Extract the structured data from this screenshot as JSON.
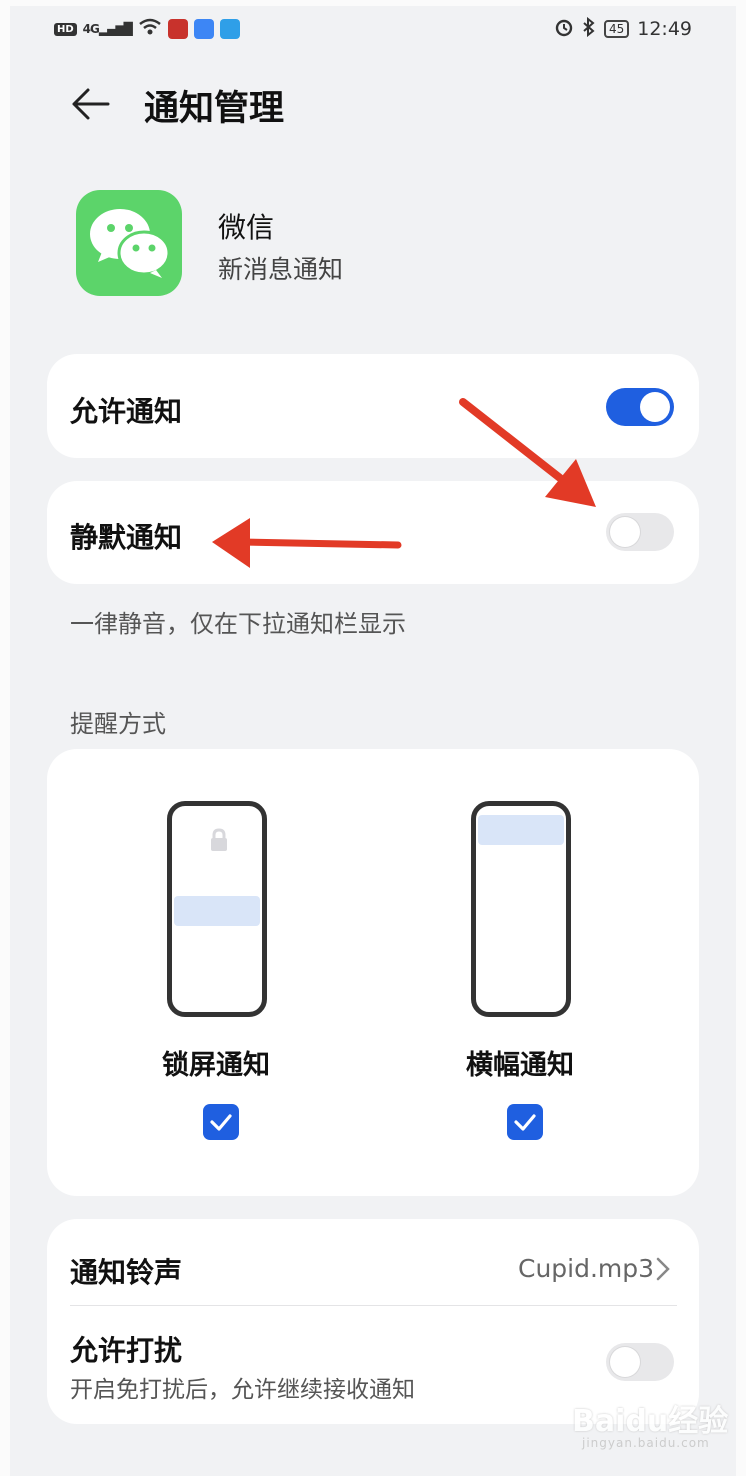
{
  "status_bar": {
    "left_indicators": [
      "HD",
      "4G"
    ],
    "time": "12:49",
    "battery": "45"
  },
  "header": {
    "title": "通知管理",
    "back_icon": "arrow-left-icon"
  },
  "app": {
    "name": "微信",
    "subtitle": "新消息通知",
    "icon": "wechat-icon",
    "icon_color": "#5cd46a"
  },
  "allow_notifications": {
    "label": "允许通知",
    "enabled": true
  },
  "silent_notifications": {
    "label": "静默通知",
    "enabled": false,
    "description": "一律静音，仅在下拉通知栏显示"
  },
  "reminder_style": {
    "section_title": "提醒方式",
    "options": [
      {
        "label": "锁屏通知",
        "checked": true
      },
      {
        "label": "横幅通知",
        "checked": true
      }
    ]
  },
  "ringtone": {
    "label": "通知铃声",
    "value": "Cupid.mp3"
  },
  "dnd": {
    "label": "允许打扰",
    "description": "开启免打扰后，允许继续接收通知",
    "enabled": false
  },
  "colors": {
    "accent": "#1f5fe0",
    "annotation_arrow": "#e23a26"
  },
  "watermark": {
    "text": "Baidu经验",
    "sub": "jingyan.baidu.com"
  }
}
